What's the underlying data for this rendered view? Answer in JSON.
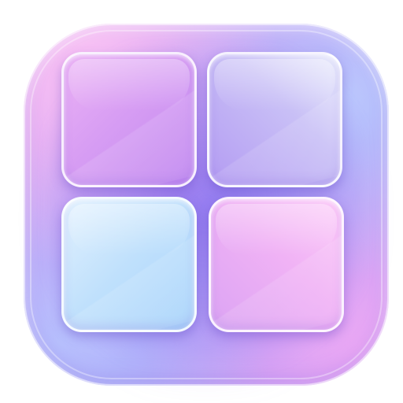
{
  "icon": {
    "name": "grid-widget-app-icon",
    "shape": "rounded-square",
    "colors": {
      "base": "#b596f4",
      "top_left_glow": "#ffc8f5",
      "bottom_right_glow": "#f0aaf5",
      "inner_shadow": "#785fef"
    },
    "tiles": [
      {
        "id": "top-left",
        "color": "#d79df3"
      },
      {
        "id": "top-right",
        "color": "#c9c0f6"
      },
      {
        "id": "bottom-left",
        "color": "#bfe0fc"
      },
      {
        "id": "bottom-right",
        "color": "#f0b2f5"
      }
    ]
  }
}
